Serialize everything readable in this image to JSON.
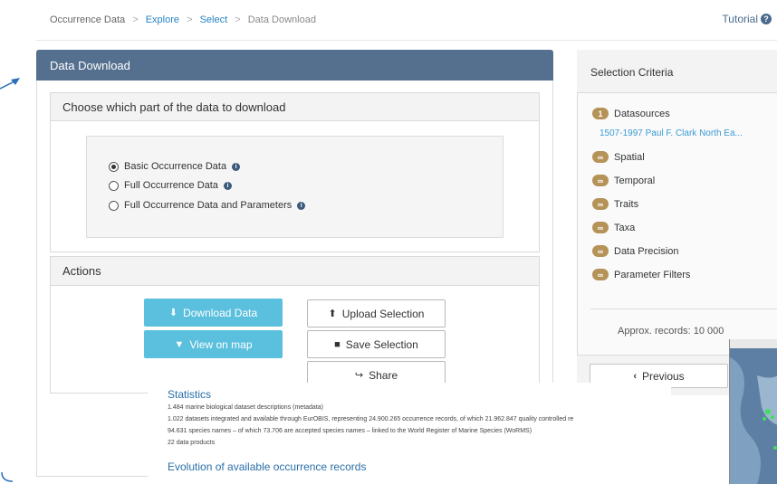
{
  "breadcrumb": {
    "root": "Occurrence Data",
    "items": [
      "Explore",
      "Select"
    ],
    "current": "Data Download",
    "separator": ">"
  },
  "tutorial": {
    "label": "Tutorial"
  },
  "panel": {
    "title": "Data Download",
    "choose": {
      "title": "Choose which part of the data to download",
      "options": [
        {
          "label": "Basic Occurrence Data",
          "selected": true
        },
        {
          "label": "Full Occurrence Data",
          "selected": false
        },
        {
          "label": "Full Occurrence Data and Parameters",
          "selected": false
        }
      ]
    },
    "actions": {
      "title": "Actions",
      "download": "Download Data",
      "view_map": "View on map",
      "upload": "Upload Selection",
      "save": "Save Selection",
      "share": "Share"
    }
  },
  "selection": {
    "title": "Selection Criteria",
    "datasources": {
      "count": "1",
      "label": "Datasources",
      "value": "1507-1997 Paul F. Clark North Ea..."
    },
    "criteria": [
      {
        "badge": "∞",
        "label": "Spatial"
      },
      {
        "badge": "∞",
        "label": "Temporal"
      },
      {
        "badge": "∞",
        "label": "Traits"
      },
      {
        "badge": "∞",
        "label": "Taxa"
      },
      {
        "badge": "∞",
        "label": "Data Precision"
      },
      {
        "badge": "∞",
        "label": "Parameter Filters"
      }
    ],
    "approx_label": "Approx. records:",
    "approx_value": "10 000",
    "previous": "Previous"
  },
  "statistics": {
    "title": "Statistics",
    "lines": [
      "1.484 marine biological dataset descriptions (metadata)",
      "1.022 datasets integrated and available through EurOBIS, representing 24.900.265 occurrence records, of which 21.962.847 quality controlled re",
      "94.631 species names – of which 73.706 are accepted species names – linked to the World Register of Marine Species (WoRMS)",
      "22 data products"
    ],
    "evolution_title": "Evolution of available occurrence records"
  },
  "colors": {
    "header": "#55708f",
    "button_blue": "#5bc0de",
    "badge": "#b59257",
    "link": "#2a83c4"
  }
}
